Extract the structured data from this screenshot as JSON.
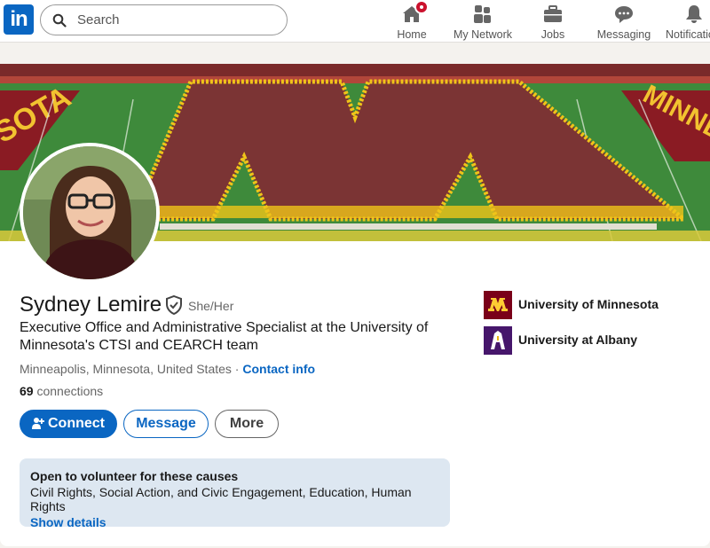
{
  "nav": {
    "search_placeholder": "Search",
    "items": [
      {
        "label": "Home",
        "icon": "home-icon"
      },
      {
        "label": "My Network",
        "icon": "my-network-icon"
      },
      {
        "label": "Jobs",
        "icon": "jobs-icon"
      },
      {
        "label": "Messaging",
        "icon": "messaging-icon"
      },
      {
        "label": "Notifications",
        "icon": "notifications-icon"
      }
    ]
  },
  "profile": {
    "name": "Sydney Lemire",
    "pronouns": "She/Her",
    "headline": "Executive Office and Administrative Specialist at the University of Minnesota's CTSI and CEARCH team",
    "location": "Minneapolis, Minnesota, United States",
    "separator": " · ",
    "contact_info": "Contact info",
    "connections_count": "69",
    "connections_label": "connections"
  },
  "actions": {
    "connect": "Connect",
    "message": "Message",
    "more": "More"
  },
  "education": [
    {
      "name": "University of Minnesota",
      "color": "#7a0019",
      "accent": "#ffcc33"
    },
    {
      "name": "University at Albany",
      "color": "#46166b",
      "accent": "#eeb211"
    }
  ],
  "volunteer": {
    "title": "Open to volunteer for these causes",
    "causes": "Civil Rights, Social Action, and Civic Engagement, Education, Human Rights",
    "link": "Show details"
  },
  "colors": {
    "brand": "#0a66c2",
    "notification": "#cb112d"
  }
}
